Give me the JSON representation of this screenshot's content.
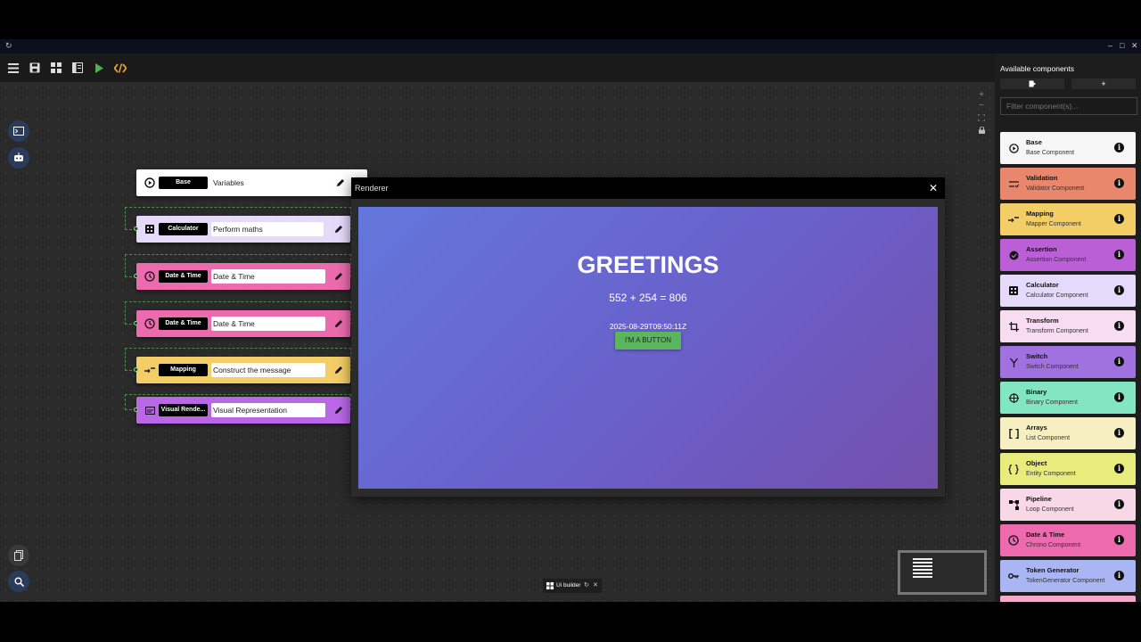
{
  "titlebar": {
    "icon": "refresh-icon",
    "controls": [
      "minimize-icon",
      "maximize-icon",
      "close-icon"
    ]
  },
  "toolbar": {
    "icons": [
      "menu-icon",
      "save-icon",
      "grid-icon",
      "panel-icon",
      "play-icon",
      "code-icon"
    ],
    "play_color": "#4caf50",
    "code_color": "#e8a23a"
  },
  "left_buttons": [
    "terminal-icon",
    "robot-icon"
  ],
  "bottom_left_buttons": [
    "copy-icon",
    "search-icon"
  ],
  "zoom_controls": [
    "+",
    "−",
    "⛶",
    "🔒"
  ],
  "nodes": [
    {
      "badge": "Base",
      "value": "Variables",
      "color": "#ffffff",
      "icon": "play-circle-icon"
    },
    {
      "badge": "Calculator",
      "value": "Perform maths",
      "color": "#e6dafb",
      "icon": "calculator-icon"
    },
    {
      "badge": "Date & Time",
      "value": "Date & Time",
      "color": "#ec6aad",
      "icon": "clock-icon"
    },
    {
      "badge": "Date & Time",
      "value": "Date & Time",
      "color": "#ec6aad",
      "icon": "clock-icon"
    },
    {
      "badge": "Mapping",
      "value": "Construct the message",
      "color": "#f3cd66",
      "icon": "mapping-icon"
    },
    {
      "badge": "Visual Rende...",
      "value": "Visual Representation",
      "color": "#ba68e8",
      "icon": "visual-icon"
    }
  ],
  "renderer": {
    "title": "Renderer",
    "greeting": "GREETINGS",
    "sum": "552 + 254 = 806",
    "timestamp": "2025-08-29T09:50:11Z",
    "button": "I'M A BUTTON"
  },
  "panel": {
    "title": "Available components",
    "filter_placeholder": "Filter component(s)...",
    "components": [
      {
        "name": "Base",
        "sub": "Base Component",
        "color": "#f6f6f6",
        "icon": "play-circle-icon"
      },
      {
        "name": "Validation",
        "sub": "Validator Component",
        "color": "#e8876b",
        "icon": "validation-icon"
      },
      {
        "name": "Mapping",
        "sub": "Mapper Component",
        "color": "#f3cd66",
        "icon": "mapping-icon"
      },
      {
        "name": "Assertion",
        "sub": "Assertion Component",
        "color": "#bb5fd6",
        "icon": "check-circle-icon"
      },
      {
        "name": "Calculator",
        "sub": "Calculator Component",
        "color": "#e6dafb",
        "icon": "calculator-icon"
      },
      {
        "name": "Transform",
        "sub": "Transform Component",
        "color": "#f8dcf1",
        "icon": "transform-icon"
      },
      {
        "name": "Switch",
        "sub": "Switch Component",
        "color": "#9f72e0",
        "icon": "switch-icon"
      },
      {
        "name": "Binary",
        "sub": "Binary Component",
        "color": "#82e6c0",
        "icon": "binary-icon"
      },
      {
        "name": "Arrays",
        "sub": "List Component",
        "color": "#f5efc2",
        "icon": "brackets-icon"
      },
      {
        "name": "Object",
        "sub": "Entity Component",
        "color": "#e8ec7c",
        "icon": "braces-icon"
      },
      {
        "name": "Pipeline",
        "sub": "Loop Component",
        "color": "#f8d8e6",
        "icon": "pipeline-icon"
      },
      {
        "name": "Date & Time",
        "sub": "Chrono Component",
        "color": "#ec6aad",
        "icon": "clock-icon"
      },
      {
        "name": "Token Generator",
        "sub": "TokenGenerator Component",
        "color": "#aab5f3",
        "icon": "key-icon"
      }
    ]
  },
  "tab_chip": {
    "label": "Ui builder"
  }
}
